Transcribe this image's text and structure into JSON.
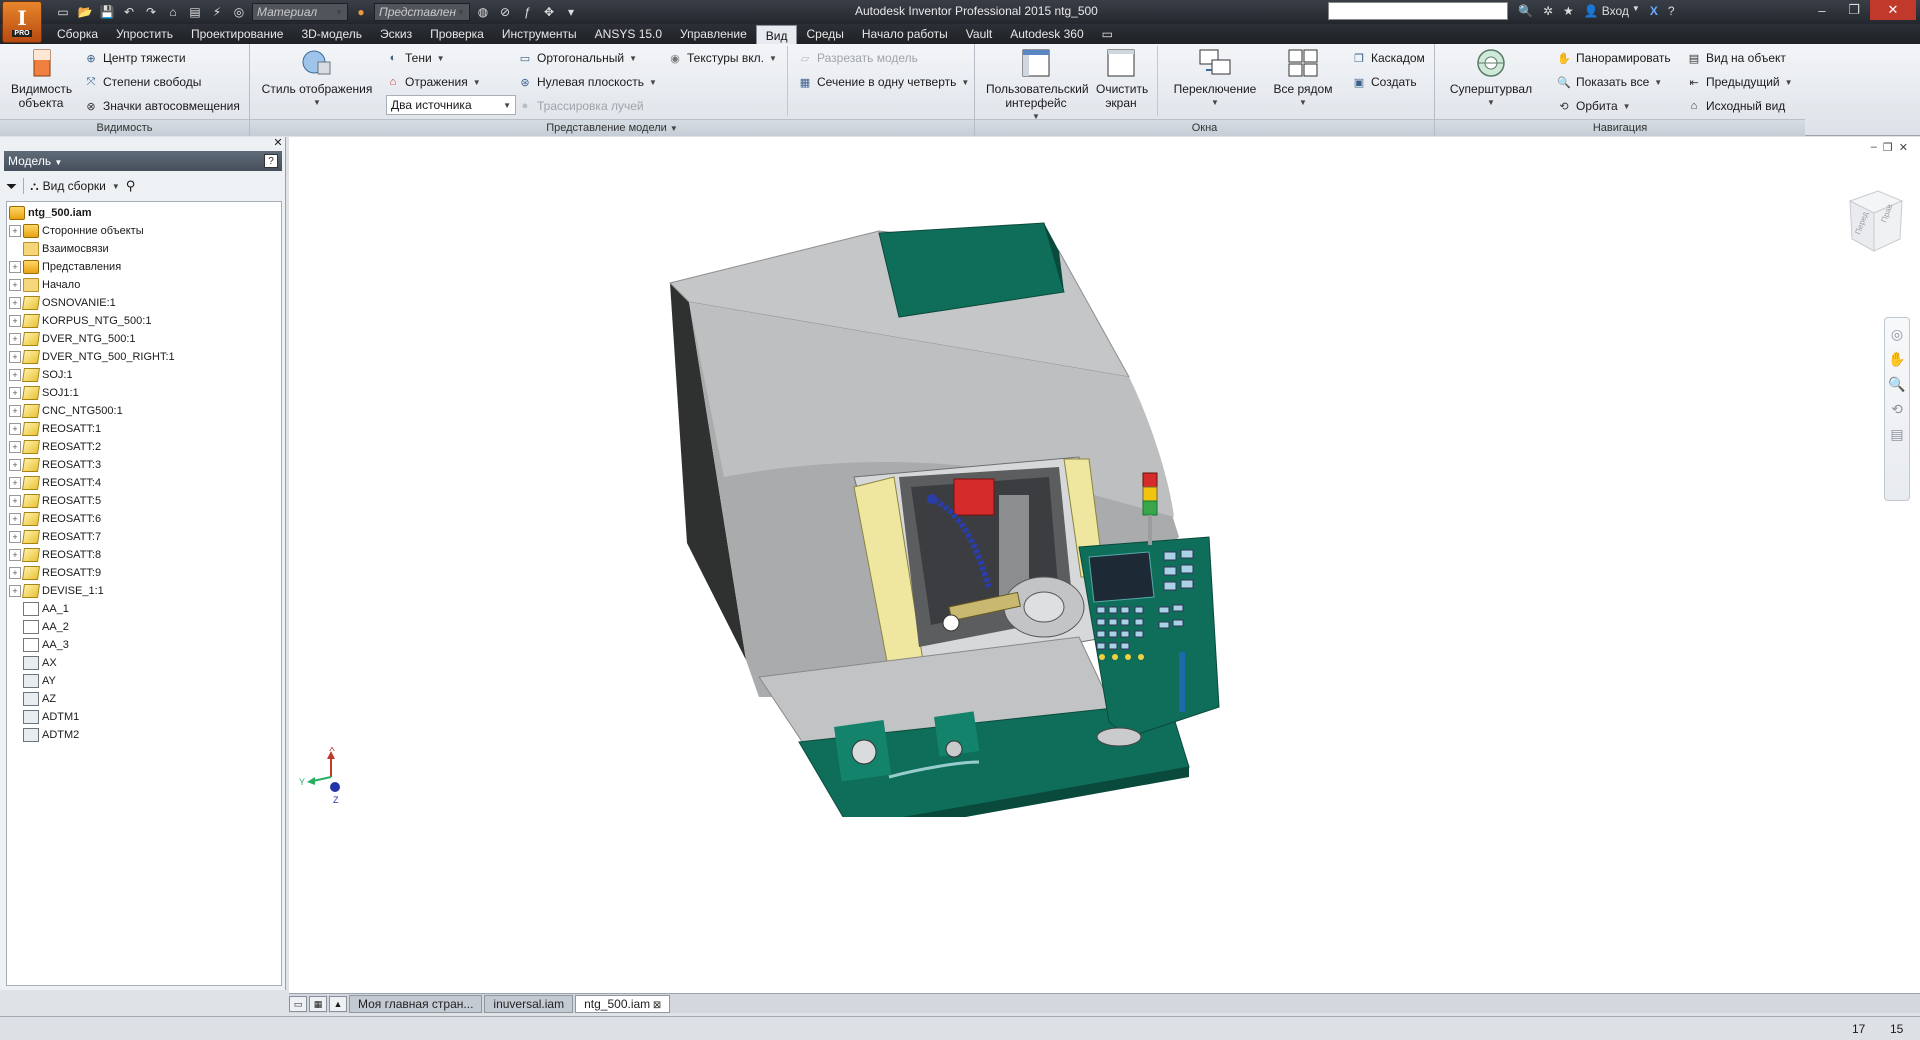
{
  "app": {
    "logo_letter": "I",
    "logo_badge": "PRO",
    "title": "Autodesk Inventor Professional 2015    ntg_500",
    "material_placeholder": "Материал",
    "appearance_placeholder": "Представлен",
    "sign_in": "Вход"
  },
  "tabs": [
    "Сборка",
    "Упростить",
    "Проектирование",
    "3D-модель",
    "Эскиз",
    "Проверка",
    "Инструменты",
    "ANSYS 15.0",
    "Управление",
    "Вид",
    "Среды",
    "Начало работы",
    "Vault",
    "Autodesk 360"
  ],
  "active_tab": "Вид",
  "ribbon": {
    "visibility": {
      "title": "Видимость",
      "object_visibility": "Видимость объекта",
      "center_of_gravity": "Центр тяжести",
      "degrees_of_freedom": "Степени свободы",
      "automate_glyphs": "Значки автосовмещения"
    },
    "appearance": {
      "title": "Представление модели",
      "visual_style": "Стиль отображения",
      "shadows": "Тени",
      "reflections": "Отражения",
      "light_source": "Два источника",
      "orthographic": "Ортогональный",
      "ground_plane": "Нулевая плоскость",
      "ray_tracing": "Трассировка лучей",
      "textures_on": "Текстуры вкл.",
      "slice_graphics": "Разрезать модель",
      "quarter_section": "Сечение в одну четверть"
    },
    "windows": {
      "title": "Окна",
      "user_interface": "Пользовательский интерфейс",
      "clean_screen": "Очистить экран",
      "switch": "Переключение",
      "tile": "Все рядом",
      "cascade": "Каскадом",
      "new": "Создать"
    },
    "navigation": {
      "title": "Навигация",
      "steering_wheel": "Суперштурвал",
      "pan": "Панорамировать",
      "zoom_all": "Показать все",
      "orbit": "Орбита",
      "look_at": "Вид на объект",
      "previous": "Предыдущий",
      "home_view": "Исходный вид"
    }
  },
  "browser": {
    "title": "Модель",
    "help": "?",
    "view_mode": "Вид сборки",
    "root": "ntg_500.iam",
    "items": [
      {
        "label": "Сторонние объекты",
        "icon": "asm",
        "exp": "+"
      },
      {
        "label": "Взаимосвязи",
        "icon": "folder",
        "exp": ""
      },
      {
        "label": "Представления",
        "icon": "asm",
        "exp": "+"
      },
      {
        "label": "Начало",
        "icon": "folder",
        "exp": "+"
      },
      {
        "label": "OSNOVANIE:1",
        "icon": "part",
        "exp": "+"
      },
      {
        "label": "KORPUS_NTG_500:1",
        "icon": "part",
        "exp": "+"
      },
      {
        "label": "DVER_NTG_500:1",
        "icon": "part",
        "exp": "+"
      },
      {
        "label": "DVER_NTG_500_RIGHT:1",
        "icon": "part",
        "exp": "+"
      },
      {
        "label": "SOJ:1",
        "icon": "part",
        "exp": "+"
      },
      {
        "label": "SOJ1:1",
        "icon": "part",
        "exp": "+"
      },
      {
        "label": "CNC_NTG500:1",
        "icon": "part",
        "exp": "+"
      },
      {
        "label": "REOSATT:1",
        "icon": "part",
        "exp": "+"
      },
      {
        "label": "REOSATT:2",
        "icon": "part",
        "exp": "+"
      },
      {
        "label": "REOSATT:3",
        "icon": "part",
        "exp": "+"
      },
      {
        "label": "REOSATT:4",
        "icon": "part",
        "exp": "+"
      },
      {
        "label": "REOSATT:5",
        "icon": "part",
        "exp": "+"
      },
      {
        "label": "REOSATT:6",
        "icon": "part",
        "exp": "+"
      },
      {
        "label": "REOSATT:7",
        "icon": "part",
        "exp": "+"
      },
      {
        "label": "REOSATT:8",
        "icon": "part",
        "exp": "+"
      },
      {
        "label": "REOSATT:9",
        "icon": "part",
        "exp": "+"
      },
      {
        "label": "DEVISE_1:1",
        "icon": "part",
        "exp": "+"
      },
      {
        "label": "AA_1",
        "icon": "sketch",
        "exp": ""
      },
      {
        "label": "AA_2",
        "icon": "sketch",
        "exp": ""
      },
      {
        "label": "AA_3",
        "icon": "sketch",
        "exp": ""
      },
      {
        "label": "AX",
        "icon": "plane",
        "exp": ""
      },
      {
        "label": "AY",
        "icon": "plane",
        "exp": ""
      },
      {
        "label": "AZ",
        "icon": "plane",
        "exp": ""
      },
      {
        "label": "ADTM1",
        "icon": "plane",
        "exp": ""
      },
      {
        "label": "ADTM2",
        "icon": "plane",
        "exp": ""
      }
    ]
  },
  "viewcube": {
    "front": "Перед",
    "right": "Прав"
  },
  "triad": {
    "x": "X",
    "y": "Y",
    "z": "Z"
  },
  "doc_tabs": [
    {
      "label": "Моя главная стран...",
      "active": false
    },
    {
      "label": "inuversal.iam",
      "active": false
    },
    {
      "label": "ntg_500.iam",
      "active": true
    }
  ],
  "status": {
    "count1": "17",
    "count2": "15"
  },
  "colors": {
    "machine_green": "#0f6e5a",
    "machine_gray": "#b9bbbd",
    "accent_yellow": "#efe7a0",
    "light_red": "#d62b2b"
  }
}
